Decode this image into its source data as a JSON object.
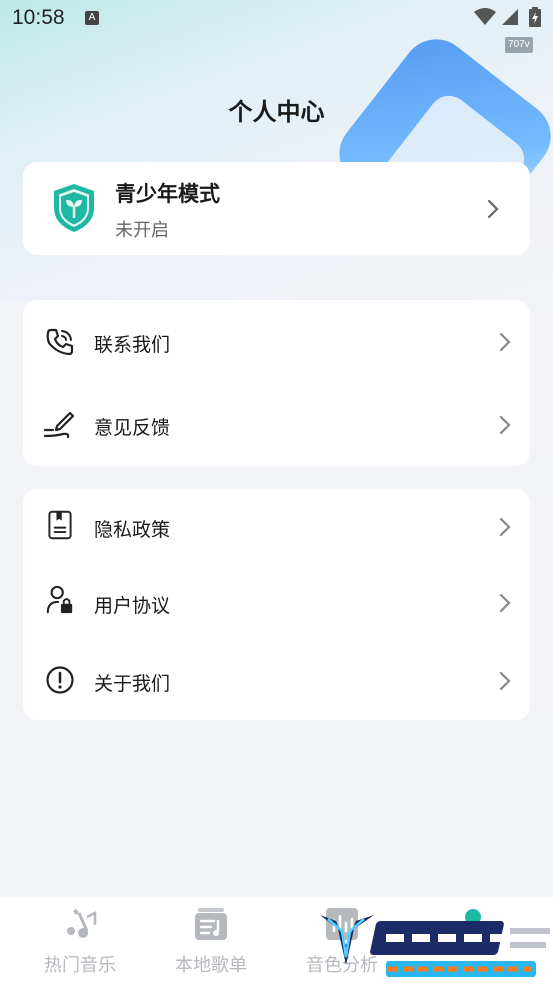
{
  "status_bar": {
    "time": "10:58",
    "speed": "707v"
  },
  "header": {
    "title": "个人中心"
  },
  "youth_mode": {
    "title": "青少年模式",
    "status": "未开启"
  },
  "group1": {
    "items": [
      {
        "label": "联系我们",
        "icon": "phone-icon"
      },
      {
        "label": "意见反馈",
        "icon": "pen-icon"
      }
    ]
  },
  "group2": {
    "items": [
      {
        "label": "隐私政策",
        "icon": "document-icon"
      },
      {
        "label": "用户协议",
        "icon": "user-lock-icon"
      },
      {
        "label": "关于我们",
        "icon": "info-icon"
      }
    ]
  },
  "tabbar": {
    "tabs": [
      {
        "label": "热门音乐",
        "icon": "music-note-icon"
      },
      {
        "label": "本地歌单",
        "icon": "playlist-icon"
      },
      {
        "label": "音色分析",
        "icon": "analysis-icon"
      },
      {
        "label": "",
        "icon": "profile-icon"
      }
    ]
  },
  "colors": {
    "accent": "#1fb8a5",
    "background": "#f1f3f6",
    "tab_inactive": "#b5b8bd"
  }
}
